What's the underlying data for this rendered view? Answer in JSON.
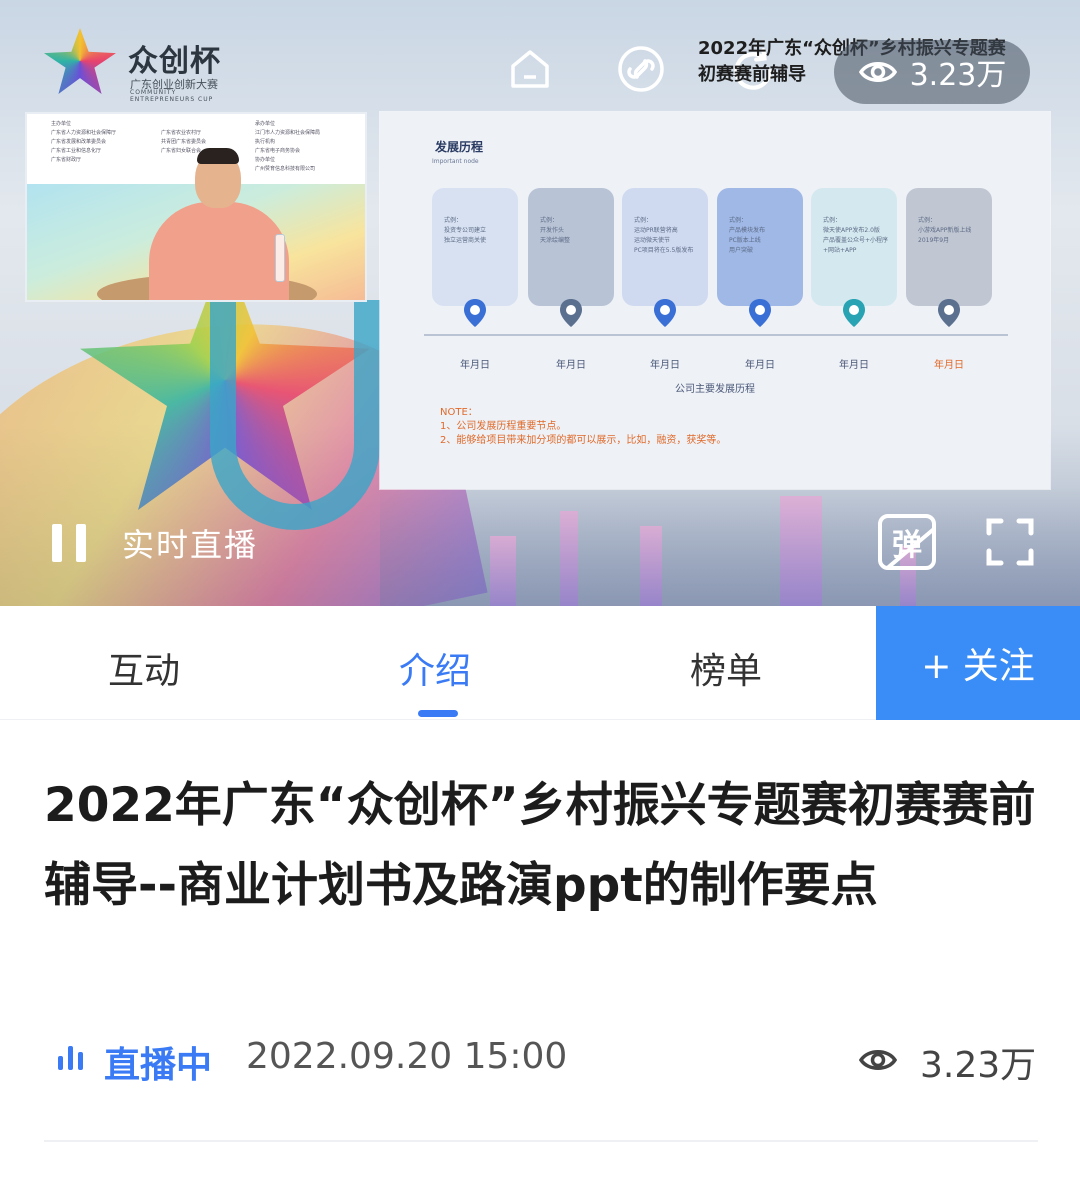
{
  "player": {
    "logo_name": "众创杯",
    "logo_subtitle": "广东创业创新大赛",
    "logo_subtitle_en": "COMMUNITY ENTREPRENEURS CUP",
    "overlay_title_line1": "2022年广东“众创杯”乡村振兴专题赛",
    "overlay_title_line2": "初赛赛前辅导",
    "view_count": "3.23万",
    "status_label": "实时直播",
    "danmu_label": "弹",
    "icons": [
      "home-icon",
      "share-link-icon",
      "refresh-icon",
      "eye-icon",
      "pause-icon",
      "danmu-off-icon",
      "fullscreen-icon"
    ]
  },
  "cam_panel": {
    "col1_heading": "主办单位",
    "col1_lines": [
      "广东省人力资源和社会保障厅",
      "广东省发展和改革委员会",
      "广东省工业和信息化厅",
      "广东省财政厅"
    ],
    "col2_lines": [
      "广东省农业农村厅",
      "共青团广东省委员会",
      "广东省妇女联合会"
    ],
    "col3_heading": "承办单位",
    "col3_lines": [
      "江门市人力资源和社会保障局"
    ],
    "col3_heading2": "执行机构",
    "col3_lines2": [
      "广东省电子商务协会"
    ],
    "col3_heading3": "协办单位",
    "col3_lines3": [
      "广州赞育信息科技有限公司"
    ]
  },
  "slide": {
    "title": "发展历程",
    "subtitle": "Important node",
    "cards": [
      {
        "text": "式例：\n投资专公司建立\n独立运营商关使",
        "color": "#d7e1f2",
        "pin": "#3a6fd6"
      },
      {
        "text": "式例：\n开发作头\n天涂绘编整",
        "color": "#b8c3d6",
        "pin": "#5b6f8f"
      },
      {
        "text": "式例：\n运动PR联营将高\n运动微天使节\nPC项目将在5.5版发布",
        "color": "#cfdaf0",
        "pin": "#3a6fd6"
      },
      {
        "text": "式例：\n产品模块发布\nPC版本上线\n用户突破",
        "color": "#9fb8e6",
        "pin": "#3a6fd6"
      },
      {
        "text": "式例：\n微天使APP发布2.0版\n产品覆盖公众号+小程序+网站+APP",
        "color": "#d4e9ef",
        "pin": "#27a3b3"
      },
      {
        "text": "式例：\n小游戏APP新版上线\n2019年9月",
        "color": "#c0c7d3",
        "pin": "#5b6f8f"
      }
    ],
    "dates": [
      "年月日",
      "年月日",
      "年月日",
      "年月日",
      "年月日",
      "年月日"
    ],
    "date_last_color": "#e06a2a",
    "caption": "公司主要发展历程",
    "note_heading": "NOTE：",
    "note_line1": "1、公司发展历程重要节点。",
    "note_line2": "2、能够给项目带来加分项的都可以展示，比如，融资，获奖等。"
  },
  "tabs": {
    "items": [
      "互动",
      "介绍",
      "榜单"
    ],
    "active_index": 1,
    "follow_label": "+ 关注"
  },
  "content": {
    "title": "2022年广东“众创杯”乡村振兴专题赛初赛赛前辅导--商业计划书及路演ppt的制作要点",
    "live_label": "直播中",
    "datetime": "2022.09.20 15:00",
    "view_count": "3.23万"
  },
  "colors": {
    "accent": "#3a7bf5",
    "follow_bg": "#3a8df6",
    "note": "#e06a2a"
  }
}
